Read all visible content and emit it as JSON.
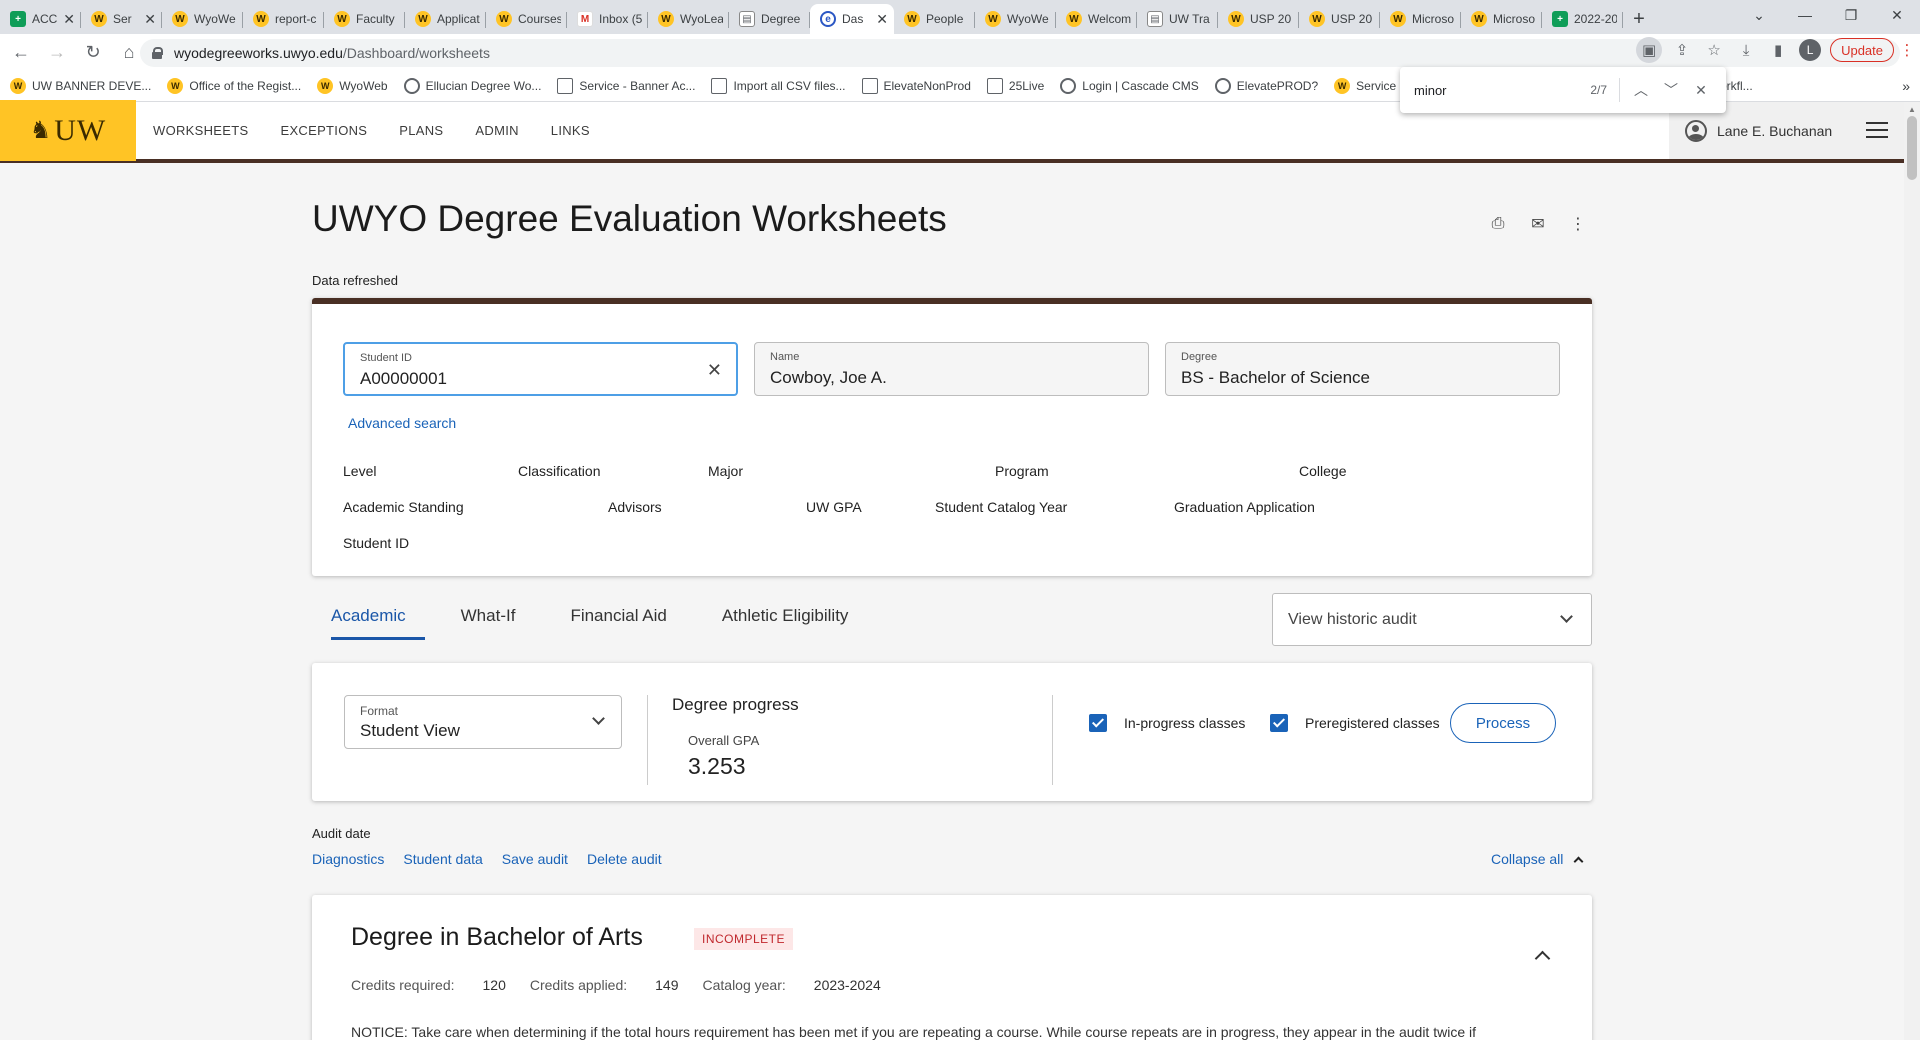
{
  "browser": {
    "tabs": [
      {
        "label": "ACC",
        "icon": "sheets",
        "closable": true
      },
      {
        "label": "Ser",
        "icon": "uw",
        "closable": true
      },
      {
        "label": "WyoWe",
        "icon": "uw"
      },
      {
        "label": "report-c",
        "icon": "uw"
      },
      {
        "label": "Faculty",
        "icon": "uw"
      },
      {
        "label": "Applicat",
        "icon": "uw"
      },
      {
        "label": "Courses",
        "icon": "uw"
      },
      {
        "label": "Inbox (5",
        "icon": "gmail"
      },
      {
        "label": "WyoLea",
        "icon": "uw"
      },
      {
        "label": "Degree",
        "icon": "doc"
      },
      {
        "label": "Das",
        "icon": "ell",
        "active": true,
        "closable": true
      },
      {
        "label": "People",
        "icon": "uw"
      },
      {
        "label": "WyoWe",
        "icon": "uw"
      },
      {
        "label": "Welcom",
        "icon": "uw"
      },
      {
        "label": "UW Tra",
        "icon": "doc"
      },
      {
        "label": "USP 20",
        "icon": "uw"
      },
      {
        "label": "USP 20",
        "icon": "uw"
      },
      {
        "label": "Microso",
        "icon": "uw"
      },
      {
        "label": "Microso",
        "icon": "uw"
      },
      {
        "label": "2022-20",
        "icon": "sheets"
      }
    ],
    "url_host": "wyodegreeworks.uwyo.edu",
    "url_path": "/Dashboard/worksheets",
    "profile_initial": "L",
    "update_label": "Update",
    "bookmarks": [
      {
        "label": "UW BANNER DEVE...",
        "icon": "uw"
      },
      {
        "label": "Office of the Regist...",
        "icon": "uw"
      },
      {
        "label": "WyoWeb",
        "icon": "uw"
      },
      {
        "label": "Ellucian Degree Wo...",
        "icon": "g"
      },
      {
        "label": "Service - Banner Ac...",
        "icon": "sq"
      },
      {
        "label": "Import all CSV files...",
        "icon": "sq"
      },
      {
        "label": "ElevateNonProd",
        "icon": "sq"
      },
      {
        "label": "25Live",
        "icon": "sq"
      },
      {
        "label": "Login | Cascade CMS",
        "icon": "g"
      },
      {
        "label": "ElevatePROD?",
        "icon": "g"
      },
      {
        "label": "Service Ca",
        "icon": "uw"
      }
    ],
    "bookmark_trailing": "orkfl...",
    "find": {
      "query": "minor",
      "count": "2/7"
    }
  },
  "header": {
    "logo_text": "UW",
    "nav": [
      "WORKSHEETS",
      "EXCEPTIONS",
      "PLANS",
      "ADMIN",
      "LINKS"
    ],
    "user_name": "Lane E. Buchanan"
  },
  "page": {
    "title": "UWYO Degree Evaluation Worksheets",
    "data_refreshed": "Data refreshed"
  },
  "student": {
    "id_label": "Student ID",
    "id_value": "A00000001",
    "name_label": "Name",
    "name_value": "Cowboy, Joe A.",
    "degree_label": "Degree",
    "degree_value": "BS - Bachelor of Science",
    "advanced_search": "Advanced search",
    "attributes": {
      "level": "Level",
      "classification": "Classification",
      "major": "Major",
      "program": "Program",
      "college": "College",
      "academic_standing": "Academic Standing",
      "advisors": "Advisors",
      "uw_gpa": "UW GPA",
      "catalog_year": "Student Catalog Year",
      "graduation_application": "Graduation Application",
      "student_id": "Student ID"
    }
  },
  "tabs": [
    "Academic",
    "What-If",
    "Financial Aid",
    "Athletic Eligibility"
  ],
  "historic_audit_label": "View historic audit",
  "progress": {
    "format_label": "Format",
    "format_value": "Student View",
    "degree_progress": "Degree progress",
    "gpa_label": "Overall GPA",
    "gpa_value": "3.253",
    "inprogress_label": "In-progress classes",
    "prereg_label": "Preregistered classes",
    "process_label": "Process"
  },
  "audit": {
    "date_label": "Audit date",
    "links": [
      "Diagnostics",
      "Student data",
      "Save audit",
      "Delete audit"
    ],
    "collapse_all": "Collapse all"
  },
  "degree_block": {
    "title": "Degree in Bachelor of Arts",
    "status": "INCOMPLETE",
    "credits_required_label": "Credits required:",
    "credits_required": "120",
    "credits_applied_label": "Credits applied:",
    "credits_applied": "149",
    "catalog_year_label": "Catalog year:",
    "catalog_year": "2023-2024",
    "notice": "NOTICE: Take care when determining if the total hours requirement has been met if you are repeating a course. While course repeats are in progress, they appear in the audit twice if"
  }
}
